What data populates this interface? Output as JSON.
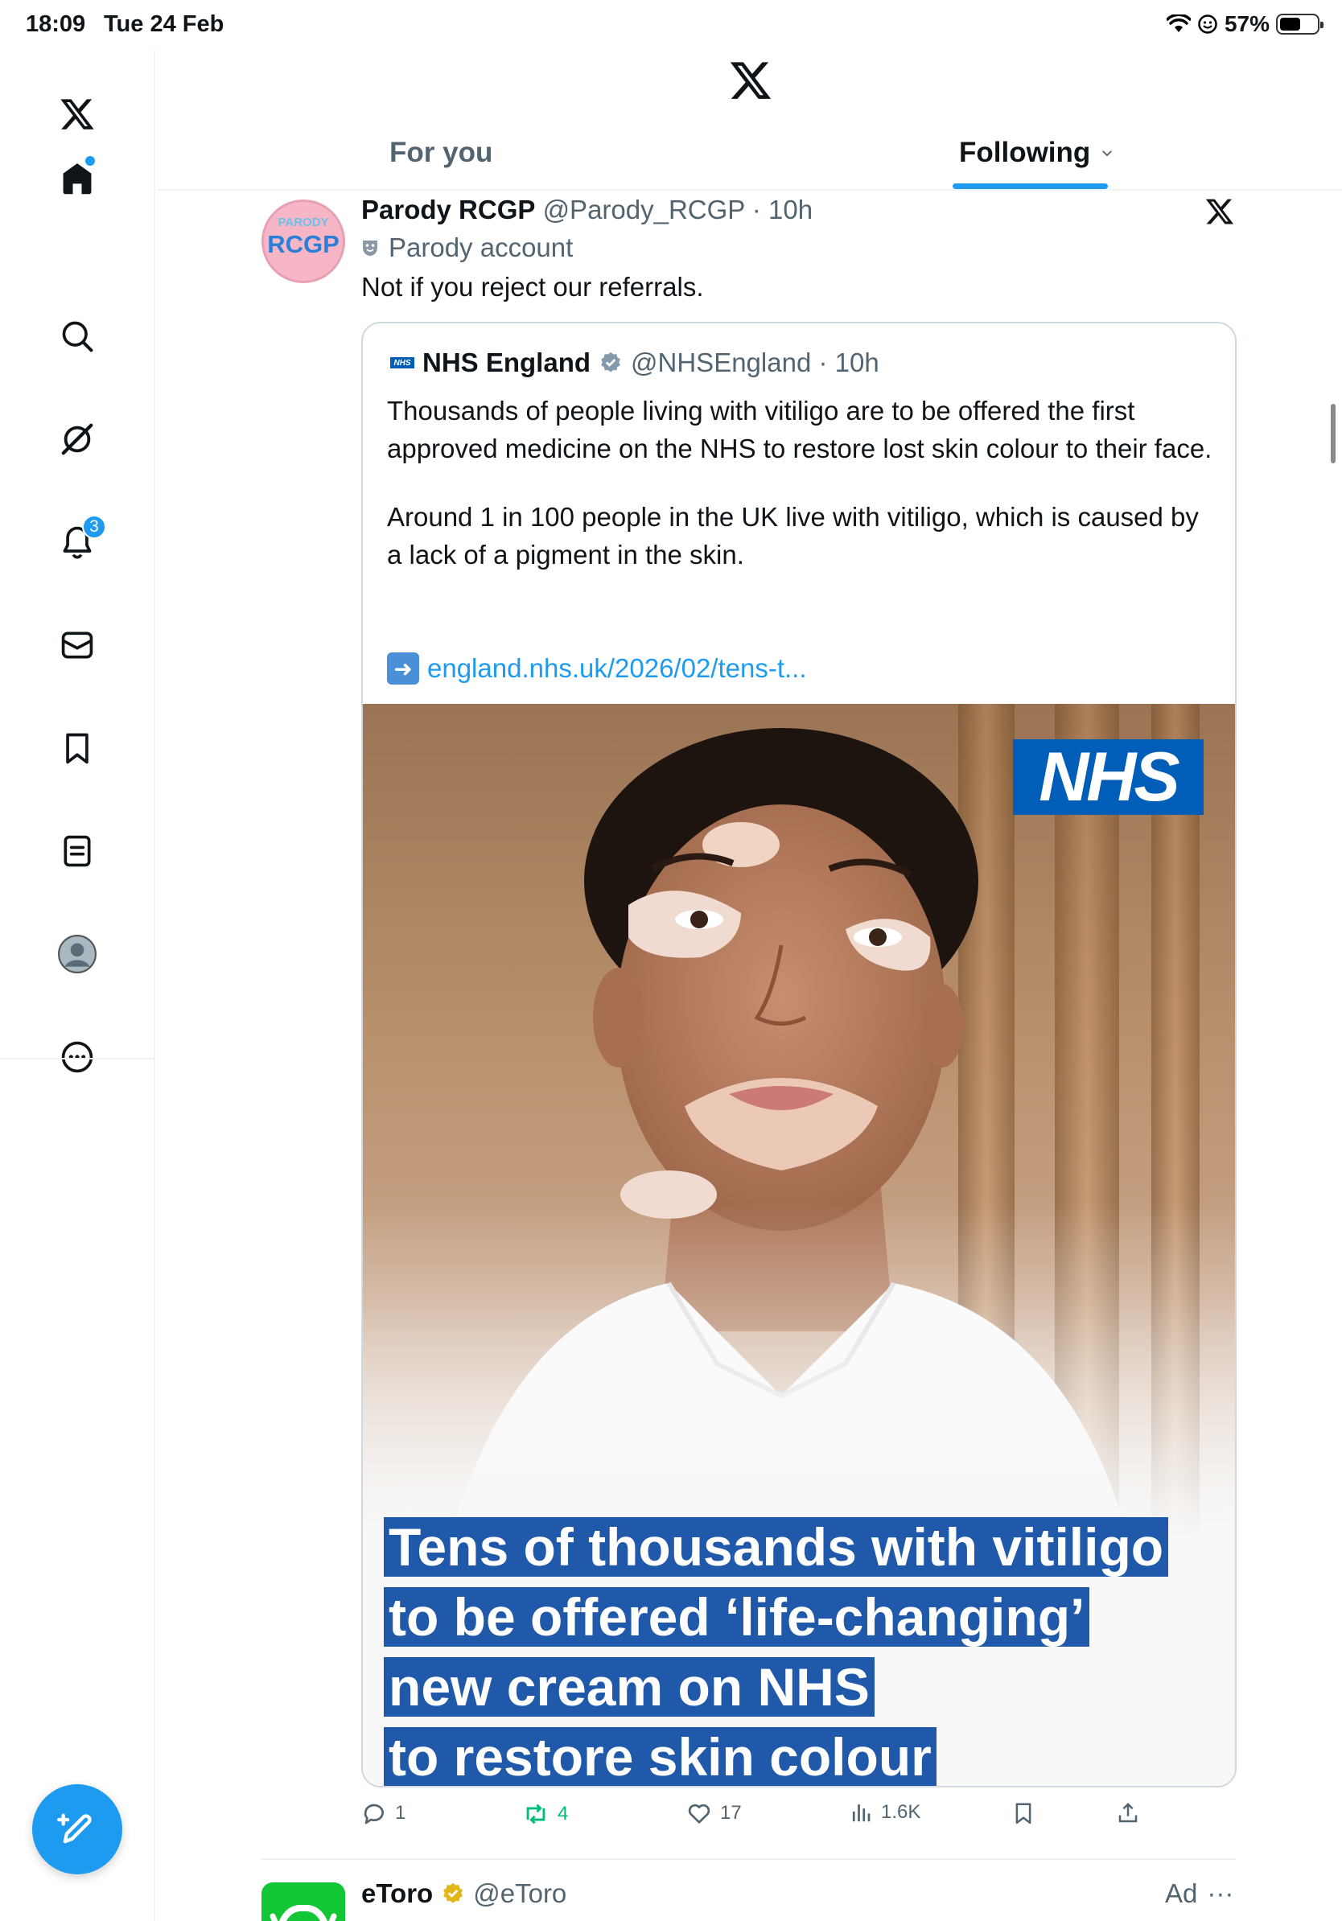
{
  "status_bar": {
    "time": "18:09",
    "date": "Tue 24 Feb",
    "battery_percent": "57%",
    "battery_level": 0.57
  },
  "sidebar": {
    "items": [
      {
        "name": "x-logo-icon"
      },
      {
        "name": "home-icon",
        "has_dot": true
      },
      {
        "name": "search-icon"
      },
      {
        "name": "grok-icon"
      },
      {
        "name": "notifications-icon",
        "badge": "3"
      },
      {
        "name": "messages-icon"
      },
      {
        "name": "bookmarks-icon"
      },
      {
        "name": "lists-icon"
      },
      {
        "name": "profile-icon"
      },
      {
        "name": "more-icon"
      }
    ],
    "notification_badge": "3"
  },
  "header": {
    "tabs": [
      {
        "label": "For you",
        "active": false
      },
      {
        "label": "Following",
        "active": true
      }
    ]
  },
  "post": {
    "avatar_small_text": "PARODY",
    "avatar_big_text": "RCGP",
    "display_name": "Parody RCGP",
    "handle_time": "@Parody_RCGP · 10h",
    "parody_label": "Parody account",
    "text": "Not if you reject our referrals.",
    "quote": {
      "logo_text": "NHS",
      "display_name": "NHS England",
      "handle_time": "@NHSEngland · 10h",
      "paragraph1": "Thousands of people living with vitiligo are to be offered the first approved medicine on the NHS to restore lost skin colour to their face.",
      "paragraph2": "Around 1 in 100 people in the UK live with vitiligo, which is caused by a lack of a pigment in the skin.",
      "link": "england.nhs.uk/2026/02/tens-t...",
      "image": {
        "nhs_logo": "NHS",
        "headline_lines": [
          "Tens of thousands with vitiligo",
          "to be offered ‘life-changing’",
          "new cream on NHS",
          "to restore skin colour"
        ]
      }
    },
    "actions": {
      "replies": "1",
      "reposts": "4",
      "likes": "17",
      "views": "1.6K"
    }
  },
  "next_post": {
    "display_name": "eToro",
    "handle": "@eToro",
    "ad_label": "Ad",
    "more": "···"
  },
  "colors": {
    "accent": "#1d9bf0",
    "repost_green": "#00ba7c",
    "nhs_blue": "#005eb8",
    "headline_bg": "#2059aa"
  }
}
